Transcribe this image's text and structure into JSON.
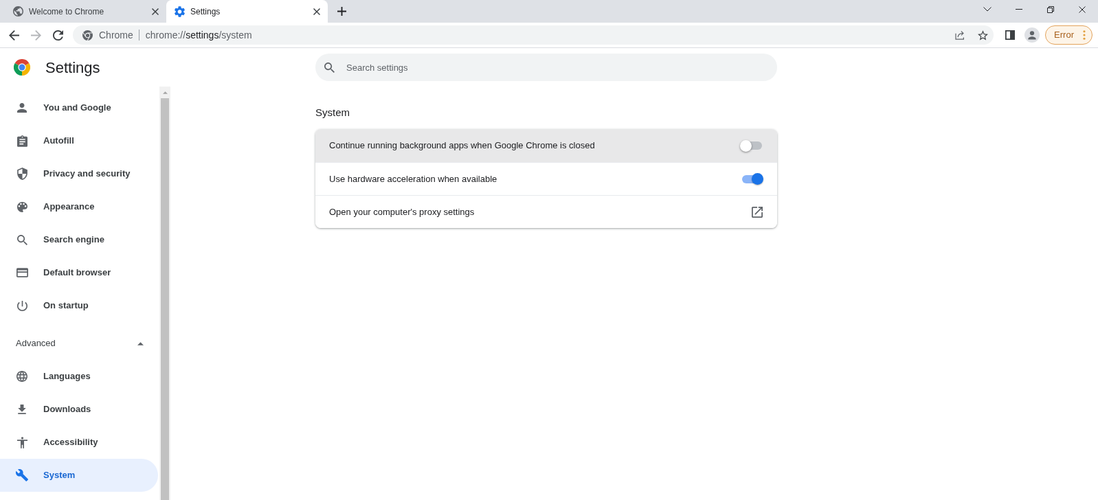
{
  "tabs": [
    {
      "title": "Welcome to Chrome",
      "selected": false
    },
    {
      "title": "Settings",
      "selected": true
    }
  ],
  "address_bar": {
    "site_label": "Chrome",
    "url": {
      "scheme": "chrome://",
      "host": "settings",
      "path": "/system"
    }
  },
  "profile_button": {
    "label": "Error"
  },
  "sidebar": {
    "title": "Settings",
    "items": [
      {
        "label": "You and Google",
        "selected": false
      },
      {
        "label": "Autofill",
        "selected": false
      },
      {
        "label": "Privacy and security",
        "selected": false
      },
      {
        "label": "Appearance",
        "selected": false
      },
      {
        "label": "Search engine",
        "selected": false
      },
      {
        "label": "Default browser",
        "selected": false
      },
      {
        "label": "On startup",
        "selected": false
      }
    ],
    "advanced": {
      "label": "Advanced",
      "expanded": true,
      "items": [
        {
          "label": "Languages",
          "selected": false
        },
        {
          "label": "Downloads",
          "selected": false
        },
        {
          "label": "Accessibility",
          "selected": false
        },
        {
          "label": "System",
          "selected": true
        }
      ]
    }
  },
  "search": {
    "placeholder": "Search settings"
  },
  "section": {
    "title": "System",
    "rows": [
      {
        "label": "Continue running background apps when Google Chrome is closed",
        "kind": "toggle",
        "on": false,
        "hovered": true
      },
      {
        "label": "Use hardware acceleration when available",
        "kind": "toggle",
        "on": true,
        "hovered": false
      },
      {
        "label": "Open your computer's proxy settings",
        "kind": "external_link",
        "hovered": false
      }
    ]
  }
}
